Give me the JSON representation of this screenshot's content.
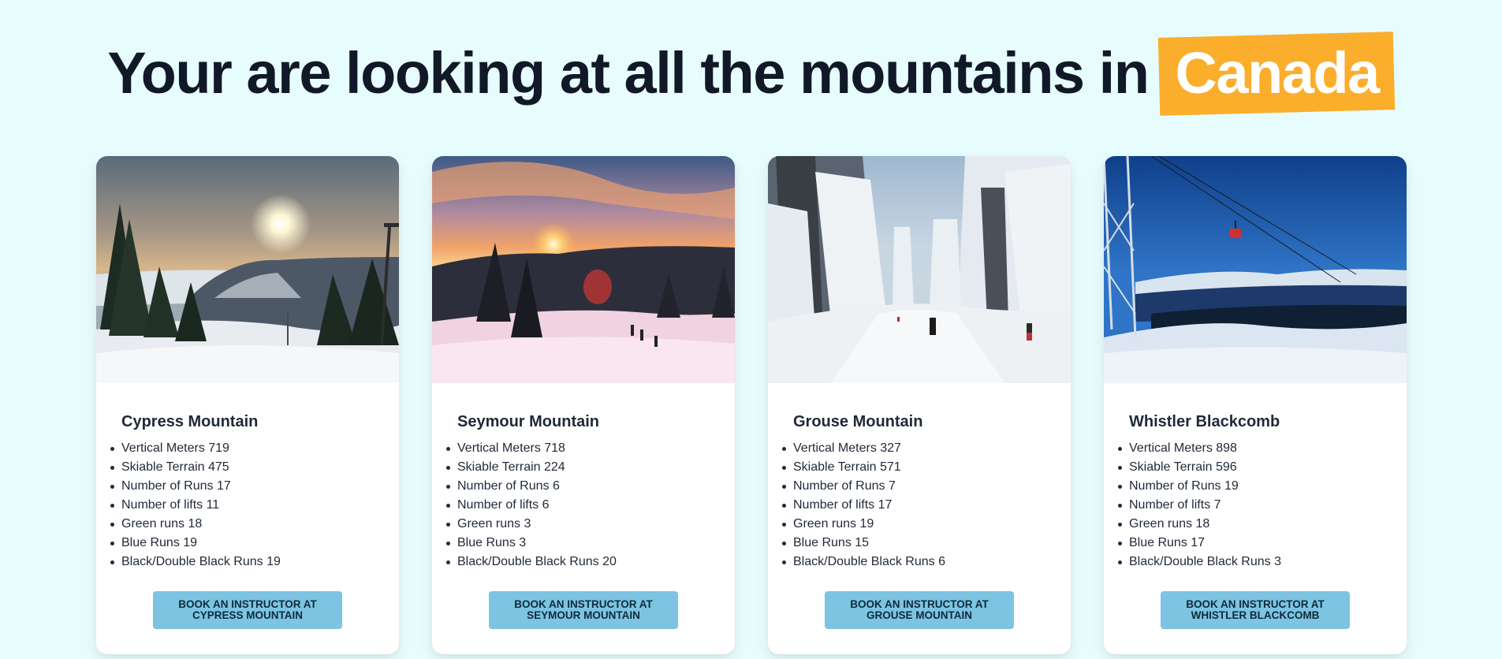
{
  "header": {
    "prefix": "Your are looking at all the mountains in",
    "country": "Canada"
  },
  "colors": {
    "background": "#e7fdfd",
    "highlight": "#fbad2c",
    "button": "#7cc4e2"
  },
  "mountains": [
    {
      "name": "Cypress Mountain",
      "stats": [
        "Vertical Meters 719",
        "Skiable Terrain 475",
        "Number of Runs 17",
        "Number of lifts 11",
        "Green runs 18",
        "Blue Runs 19",
        "Black/Double Black Runs 19"
      ],
      "button": {
        "line1": "BOOK AN INSTRUCTOR AT",
        "line2": "CYPRESS MOUNTAIN"
      }
    },
    {
      "name": "Seymour Mountain",
      "stats": [
        "Vertical Meters 718",
        "Skiable Terrain 224",
        "Number of Runs 6",
        "Number of lifts 6",
        "Green runs 3",
        "Blue Runs 3",
        "Black/Double Black Runs 20"
      ],
      "button": {
        "line1": "BOOK AN INSTRUCTOR AT",
        "line2": "SEYMOUR MOUNTAIN"
      }
    },
    {
      "name": "Grouse Mountain",
      "stats": [
        "Vertical Meters 327",
        "Skiable Terrain 571",
        "Number of Runs 7",
        "Number of lifts 17",
        "Green runs 19",
        "Blue Runs 15",
        "Black/Double Black Runs 6"
      ],
      "button": {
        "line1": "BOOK AN INSTRUCTOR AT",
        "line2": "GROUSE MOUNTAIN"
      }
    },
    {
      "name": "Whistler Blackcomb",
      "stats": [
        "Vertical Meters 898",
        "Skiable Terrain 596",
        "Number of Runs 19",
        "Number of lifts 7",
        "Green runs 18",
        "Blue Runs 17",
        "Black/Double Black Runs 3"
      ],
      "button": {
        "line1": "BOOK AN INSTRUCTOR AT",
        "line2": "WHISTLER BLACKCOMB"
      }
    }
  ]
}
